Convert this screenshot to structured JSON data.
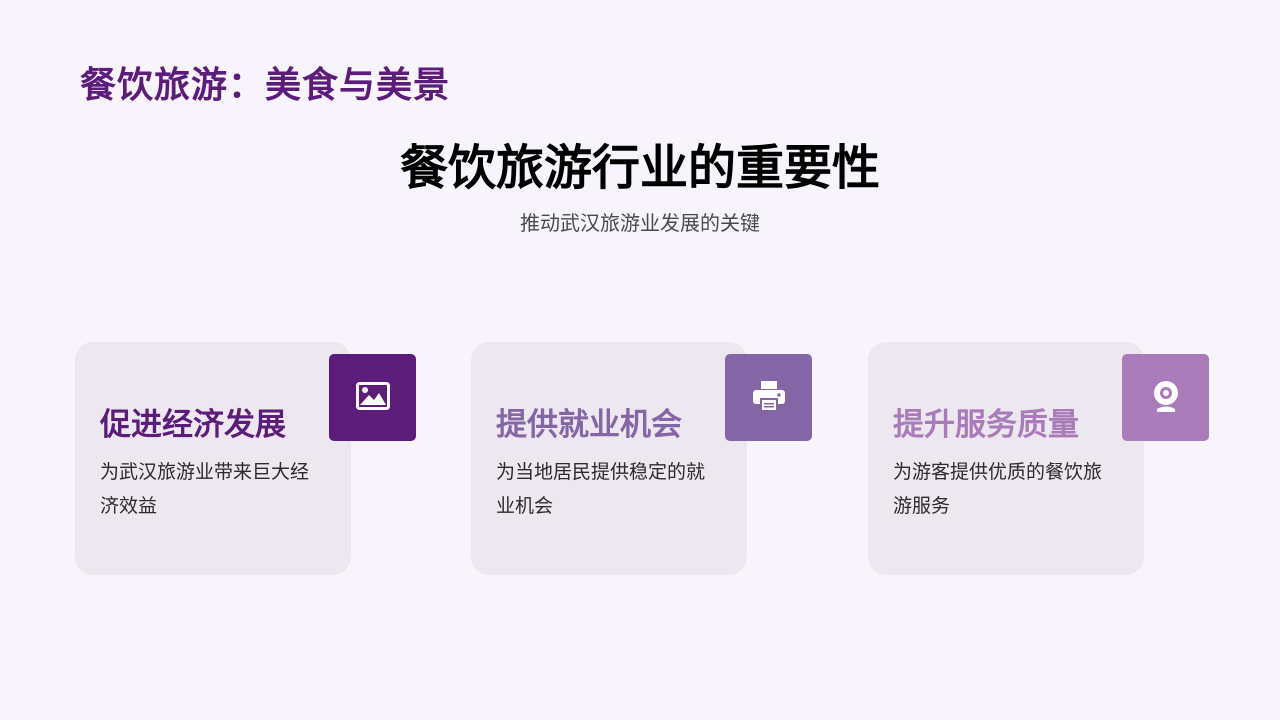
{
  "header": {
    "deck_title": "餐饮旅游：美食与美景"
  },
  "main": {
    "title": "餐饮旅游行业的重要性",
    "subtitle": "推动武汉旅游业发展的关键"
  },
  "cards": [
    {
      "heading": "促进经济发展",
      "description": "为武汉旅游业带来巨大经济效益",
      "icon": "image-icon",
      "accent_color": "#5c1c7a"
    },
    {
      "heading": "提供就业机会",
      "description": "为当地居民提供稳定的就业机会",
      "icon": "printer-icon",
      "accent_color": "#8465a6"
    },
    {
      "heading": "提升服务质量",
      "description": "为游客提供优质的餐饮旅游服务",
      "icon": "webcam-icon",
      "accent_color": "#a97bb8"
    }
  ],
  "colors": {
    "background": "#f8f4fb",
    "card_background": "#ede8ef"
  }
}
